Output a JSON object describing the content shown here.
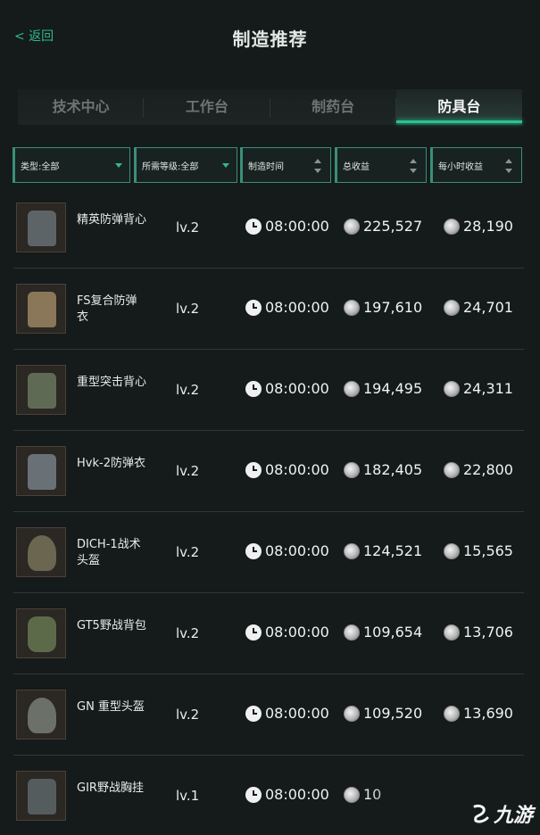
{
  "header": {
    "back_label": "< 返回",
    "title": "制造推荐"
  },
  "tabs": [
    {
      "label": "技术中心",
      "active": false
    },
    {
      "label": "工作台",
      "active": false
    },
    {
      "label": "制药台",
      "active": false
    },
    {
      "label": "防具台",
      "active": true
    }
  ],
  "filters": {
    "type": "类型:全部",
    "level": "所需等级:全部",
    "time": "制造时间",
    "total": "总收益",
    "hourly": "每小时收益"
  },
  "items": [
    {
      "name": "精英防弹背心",
      "level": "lv.2",
      "time": "08:00:00",
      "total": "225,527",
      "hourly": "28,190",
      "color": "#5d6468"
    },
    {
      "name": "FS复合防弹衣",
      "level": "lv.2",
      "time": "08:00:00",
      "total": "197,610",
      "hourly": "24,701",
      "color": "#8a7658"
    },
    {
      "name": "重型突击背心",
      "level": "lv.2",
      "time": "08:00:00",
      "total": "194,495",
      "hourly": "24,311",
      "color": "#5f6a55"
    },
    {
      "name": "Hvk-2防弹衣",
      "level": "lv.2",
      "time": "08:00:00",
      "total": "182,405",
      "hourly": "22,800",
      "color": "#6a7176"
    },
    {
      "name": "DICH-1战术头盔",
      "level": "lv.2",
      "time": "08:00:00",
      "total": "124,521",
      "hourly": "15,565",
      "color": "#6a6650"
    },
    {
      "name": "GT5野战背包",
      "level": "lv.2",
      "time": "08:00:00",
      "total": "109,654",
      "hourly": "13,706",
      "color": "#5c6a4a"
    },
    {
      "name": "GN 重型头盔",
      "level": "lv.2",
      "time": "08:00:00",
      "total": "109,520",
      "hourly": "13,690",
      "color": "#6b7068"
    },
    {
      "name": "GIR野战胸挂",
      "level": "lv.1",
      "time": "08:00:00",
      "total": "10",
      "hourly": "",
      "color": "#555c5e"
    }
  ],
  "watermark": {
    "text": "九游"
  },
  "icons": {
    "time": "clock-icon",
    "currency": "coin-icon"
  }
}
